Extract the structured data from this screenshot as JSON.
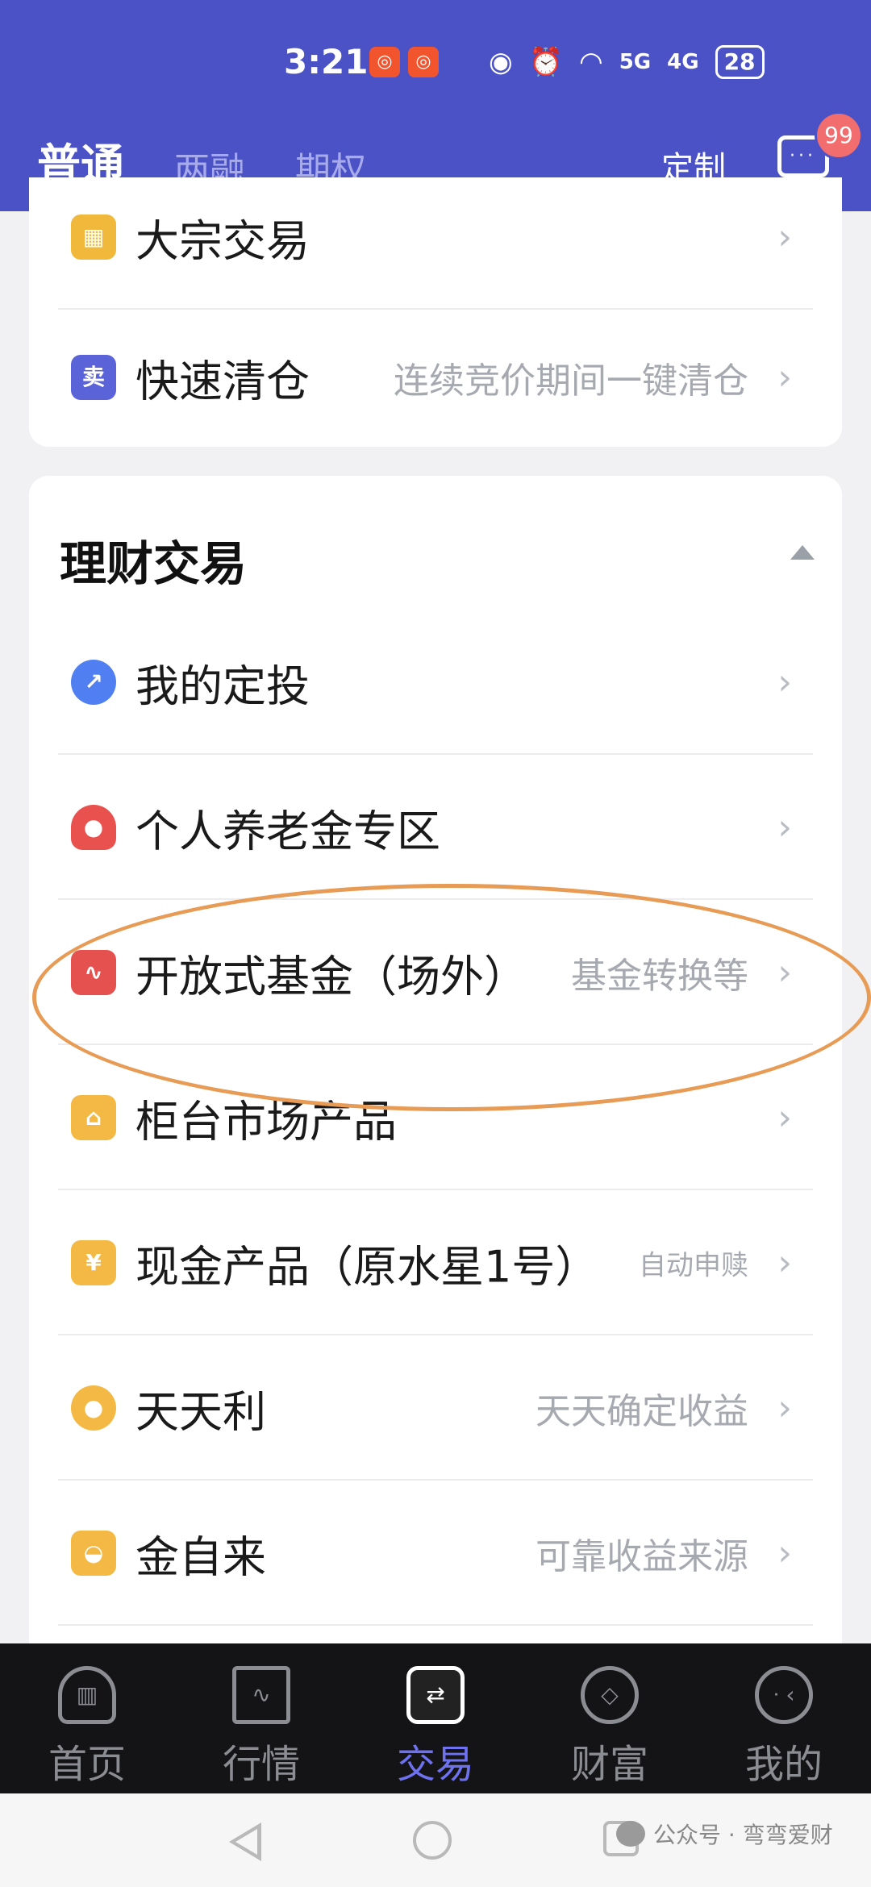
{
  "status_bar": {
    "time": "3:21",
    "battery": "28",
    "signal_5g": "5G",
    "signal_4g": "4G"
  },
  "header": {
    "tabs": [
      {
        "label": "普通"
      },
      {
        "label": "两融"
      },
      {
        "label": "期权"
      }
    ],
    "custom_label": "定制",
    "message_badge": "99"
  },
  "top_card": {
    "items": [
      {
        "title": "大宗交易",
        "subtitle": ""
      },
      {
        "title": "快速清仓",
        "subtitle": "连续竞价期间一键清仓",
        "icon_text": "卖"
      }
    ]
  },
  "finance_section": {
    "title": "理财交易",
    "items": [
      {
        "title": "我的定投",
        "subtitle": ""
      },
      {
        "title": "个人养老金专区",
        "subtitle": ""
      },
      {
        "title": "开放式基金（场外）",
        "subtitle": "基金转换等"
      },
      {
        "title": "柜台市场产品",
        "subtitle": ""
      },
      {
        "title": "现金产品（原水星1号）",
        "subtitle": "自动申赎",
        "icon_text": "¥"
      },
      {
        "title": "天天利",
        "subtitle": "天天确定收益"
      },
      {
        "title": "金自来",
        "subtitle": "可靠收益来源"
      }
    ]
  },
  "bottom_nav": {
    "items": [
      {
        "label": "首页"
      },
      {
        "label": "行情"
      },
      {
        "label": "交易"
      },
      {
        "label": "财富"
      },
      {
        "label": "我的"
      }
    ]
  },
  "watermark": "公众号 · 弯弯爱财",
  "colors": {
    "header": "#4a52c6",
    "accent": "#6e72f0",
    "highlight_oval": "#e79b55"
  }
}
